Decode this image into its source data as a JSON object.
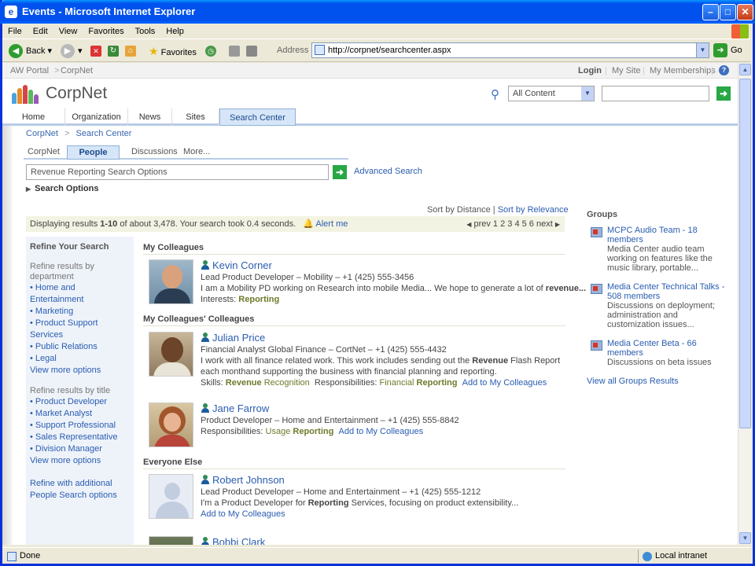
{
  "window": {
    "title": "Events - Microsoft Internet Explorer"
  },
  "menu": [
    "File",
    "Edit",
    "View",
    "Favorites",
    "Tools",
    "Help"
  ],
  "toolbar": {
    "back": "Back",
    "favorites": "Favorites",
    "address_label": "Address",
    "url": "http://corpnet/searchcenter.aspx",
    "go": "Go"
  },
  "portal": {
    "crumb1": "AW Portal",
    "crumb2": "CorpNet",
    "login": "Login",
    "mysite": "My Site",
    "memberships": "My Memberships"
  },
  "site": {
    "name": "CorpNet",
    "scope": "All Content"
  },
  "nav": [
    "Home",
    "Organization",
    "News",
    "Sites",
    "Search Center"
  ],
  "breadcrumb": {
    "a": "CorpNet",
    "sep": ">",
    "b": "Search Center"
  },
  "subtabs": [
    "CorpNet",
    "People",
    "Discussions",
    "More..."
  ],
  "search": {
    "query": "Revenue Reporting Search Options",
    "advanced": "Advanced Search",
    "options": "Search Options"
  },
  "sort": {
    "distance": "Sort by Distance",
    "sep": "|",
    "relevance": "Sort by Relevance"
  },
  "results": {
    "pre": "Displaying results ",
    "range": "1-10",
    "post": " of about 3,478. Your search took 0.4 seconds.",
    "alert": "Alert me",
    "prev": "prev",
    "pages": "1 2 3 4 5 6",
    "next": "next"
  },
  "refine": {
    "title": "Refine Your Search",
    "dept_label": "Refine results by department",
    "dept": [
      "Home and Entertainment",
      "Marketing",
      "Product Support Services",
      "Public Relations",
      "Legal"
    ],
    "more1": "View more options",
    "title_label": "Refine results by title",
    "titles": [
      "Product Developer",
      "Market Analyst",
      "Support Professional",
      "Sales Representative",
      "Division Manager"
    ],
    "more2": "View more options",
    "additional": "Refine with additional People Search options"
  },
  "sections": {
    "colleagues": "My Colleagues",
    "colleagues2": "My Colleagues' Colleagues",
    "everyone": "Everyone Else"
  },
  "people": [
    {
      "name": "Kevin Corner",
      "line1": "Lead Product Developer – Mobility – +1 (425) 555-3456",
      "line2a": "I am a Mobility PD working on Research into mobile Media... We hope to generate a lot of ",
      "line2b": "revenue...",
      "lbl": "Interests: ",
      "kw": "Reporting"
    },
    {
      "name": "Julian Price",
      "line1": "Financial Analyst Global Finance – CortNet – +1 (425) 555-4432",
      "line2a": "I work with all finance related work. This work includes sending out the ",
      "kw1": "Revenue",
      "line2b": " Flash Report each monthand supporting the business with financial planning and reporting.",
      "skills": "Skills: ",
      "s1": "Revenue",
      "s2": " Recognition",
      "resp": "Responsibilities: ",
      "r1": "Financial ",
      "r2": "Reporting",
      "add": "Add to My Colleagues"
    },
    {
      "name": "Jane Farrow",
      "line1": "Product Developer – Home and Entertainment – +1 (425) 555-8842",
      "resp": "Responsibilities: ",
      "r1": "Usage ",
      "r2": "Reporting",
      "add": "Add to My Colleagues"
    },
    {
      "name": "Robert Johnson",
      "line1": "Lead Product Developer – Home and Entertainment – +1 (425) 555-1212",
      "line2a": "I'm a Product Developer for ",
      "kw": "Reporting",
      "line2b": " Services, focusing on product extensibility...",
      "add": "Add to My Colleagues"
    },
    {
      "name": "Bobbi Clark"
    }
  ],
  "groups": {
    "title": "Groups",
    "items": [
      {
        "title": "MCPC Audio Team - 18 members",
        "desc": "Media Center audio team working on features like the music library, portable..."
      },
      {
        "title": "Media Center Technical Talks - 508 members",
        "desc": "Discussions on deployment; administration and customization issues..."
      },
      {
        "title": "Media Center Beta - 66 members",
        "desc": "Discussions on beta issues"
      }
    ],
    "all": "View all Groups Results"
  },
  "status": {
    "left": "Done",
    "zone": "Local intranet"
  }
}
